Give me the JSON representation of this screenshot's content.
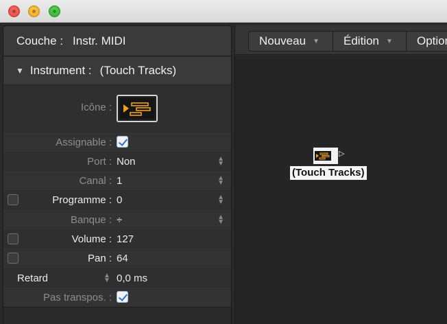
{
  "window": {
    "traffic_lights": [
      "close",
      "minimize",
      "zoom"
    ]
  },
  "inspector": {
    "header": {
      "label": "Couche :",
      "value": "Instr. MIDI"
    },
    "section": {
      "label": "Instrument :",
      "value": "(Touch Tracks)"
    },
    "icon_row": {
      "label": "Icône :"
    },
    "rows": {
      "assignable": {
        "label": "Assignable :",
        "checked": true
      },
      "port": {
        "label": "Port :",
        "value": "Non"
      },
      "canal": {
        "label": "Canal :",
        "value": "1"
      },
      "programme": {
        "label": "Programme :",
        "value": "0",
        "checked": false
      },
      "banque": {
        "label": "Banque :",
        "value": "÷"
      },
      "volume": {
        "label": "Volume :",
        "value": "127",
        "checked": false
      },
      "pan": {
        "label": "Pan :",
        "value": "64",
        "checked": false
      },
      "retard": {
        "label": "Retard",
        "value": "0,0 ms"
      },
      "pas_transpos": {
        "label": "Pas transpos. :",
        "checked": true
      }
    }
  },
  "environment": {
    "menu": {
      "nouveau": "Nouveau",
      "edition": "Édition",
      "options": "Options"
    },
    "object": {
      "label": "(Touch Tracks)"
    }
  },
  "colors": {
    "accent_orange": "#f0a020",
    "checkbox_blue": "#2a6fdb"
  }
}
